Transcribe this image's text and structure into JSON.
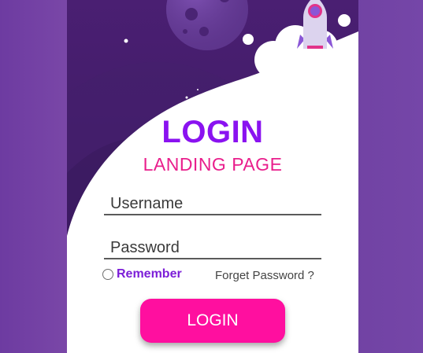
{
  "header": {
    "title": "LOGIN",
    "subtitle": "LANDING PAGE"
  },
  "form": {
    "username_placeholder": "Username",
    "password_placeholder": "Password",
    "remember_label": "Remember",
    "forgot_link": "Forget Password ?",
    "submit_label": "LOGIN"
  },
  "colors": {
    "title": "#8a12f0",
    "subtitle": "#e91e8c",
    "button": "#ff0f9f",
    "card_background": "#4a1f72",
    "page_background": "#7546a8"
  },
  "illustration": {
    "planet": "planet-icon",
    "rocket": "rocket-icon",
    "cloud": "cloud-icon",
    "stars": "star-icon"
  }
}
